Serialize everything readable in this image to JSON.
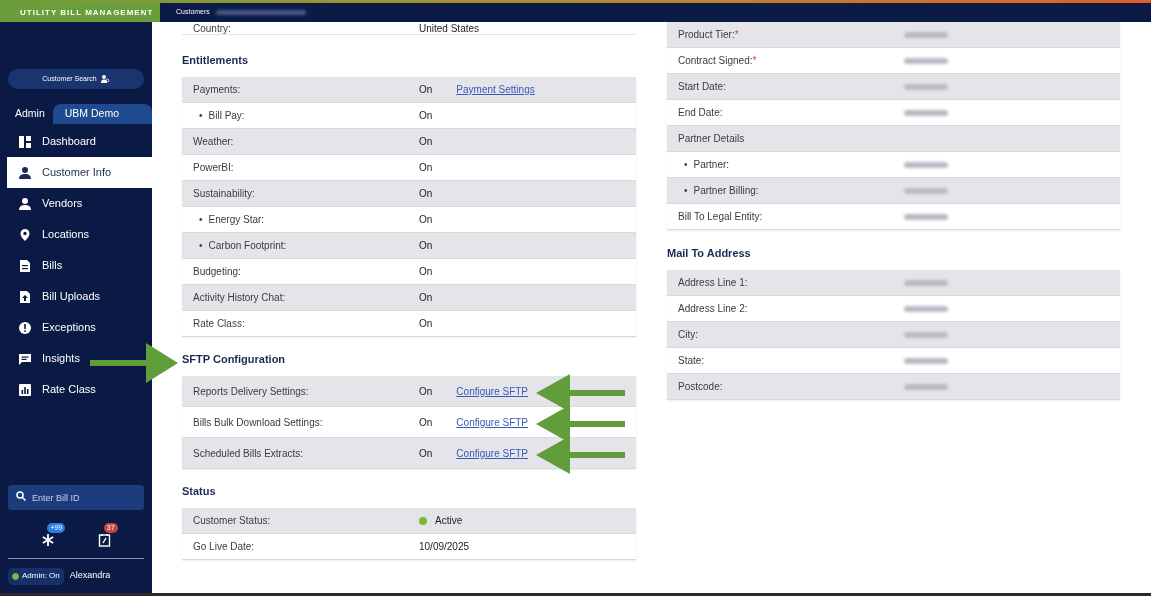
{
  "header": {
    "logo": "UTILITY BILL MANAGEMENT",
    "breadcrumb": "Customers"
  },
  "sidebar": {
    "search_button": "Customer Search",
    "tabs": [
      {
        "label": "Admin",
        "selected": false
      },
      {
        "label": "UBM Demo",
        "selected": true
      }
    ],
    "items": [
      {
        "label": "Dashboard",
        "selected": false
      },
      {
        "label": "Customer Info",
        "selected": true
      },
      {
        "label": "Vendors",
        "selected": false
      },
      {
        "label": "Locations",
        "selected": false
      },
      {
        "label": "Bills",
        "selected": false
      },
      {
        "label": "Bill Uploads",
        "selected": false
      },
      {
        "label": "Exceptions",
        "selected": false
      },
      {
        "label": "Insights",
        "selected": false
      },
      {
        "label": "Rate Class",
        "selected": false
      }
    ],
    "bill_search": {
      "placeholder": "Enter Bill ID"
    },
    "badges": [
      {
        "count": "+99",
        "color": "#2f7de1"
      },
      {
        "count": "37",
        "color": "#c8443f"
      }
    ],
    "admin_toggle": {
      "label": "Admin: On",
      "on": true
    },
    "user": "Alexandra"
  },
  "left": {
    "top_row": {
      "label": "Country:",
      "value": "United States"
    },
    "sections": [
      {
        "title": "Entitlements",
        "rows": [
          {
            "label": "Payments:",
            "value": "On",
            "link": "Payment Settings",
            "children": [
              {
                "bullet": "•",
                "label": "Bill Pay:",
                "value": "On"
              }
            ]
          },
          {
            "label": "Weather:",
            "value": "On"
          },
          {
            "label": "PowerBI:",
            "value": "On"
          },
          {
            "label": "Sustainability:",
            "value": "On",
            "children": [
              {
                "bullet": "•",
                "label": "Energy Star:",
                "value": "On"
              },
              {
                "bullet": "•",
                "label": "Carbon Footprint:",
                "value": "On"
              }
            ]
          },
          {
            "label": "Budgeting:",
            "value": "On"
          },
          {
            "label": "Activity History Chat:",
            "value": "On"
          },
          {
            "label": "Rate Class:",
            "value": "On"
          }
        ]
      },
      {
        "title": "SFTP Configuration",
        "rows": [
          {
            "label": "Reports Delivery Settings:",
            "value": "On",
            "link": "Configure SFTP"
          },
          {
            "label": "Bills Bulk Download Settings:",
            "value": "On",
            "link": "Configure SFTP"
          },
          {
            "label": "Scheduled Bills Extracts:",
            "value": "On",
            "link": "Configure SFTP"
          }
        ]
      },
      {
        "title": "Status",
        "rows": [
          {
            "label": "Customer Status:",
            "value": "Active",
            "color": "#7cb83a"
          },
          {
            "label": "Go Live Date:",
            "value": "10/09/2025"
          }
        ]
      }
    ]
  },
  "right": {
    "sections": [
      {
        "rows": [
          {
            "kind": "blurred",
            "label": "Product Tier:",
            "mark": "*"
          },
          {
            "kind": "blurred",
            "label": "Contract Signed:",
            "mark": "*"
          },
          {
            "kind": "blurred",
            "label": "Start Date:"
          },
          {
            "kind": "blurred",
            "label": "End Date:"
          },
          {
            "kind": "heading",
            "label": "Partner Details",
            "children": [
              {
                "kind": "blurred",
                "bullet": "•",
                "label": "Partner:"
              },
              {
                "kind": "blurred",
                "bullet": "•",
                "label": "Partner Billing:"
              }
            ]
          },
          {
            "kind": "blurred",
            "label": "Bill To Legal Entity:"
          }
        ]
      },
      {
        "title": "Mail To Address",
        "rows": [
          {
            "kind": "blurred",
            "label": "Address Line 1:"
          },
          {
            "kind": "blurred",
            "label": "Address Line 2:"
          },
          {
            "kind": "blurred",
            "label": "City:"
          },
          {
            "kind": "blurred",
            "label": "State:"
          },
          {
            "kind": "blurred",
            "label": "Postcode:"
          }
        ]
      }
    ]
  }
}
